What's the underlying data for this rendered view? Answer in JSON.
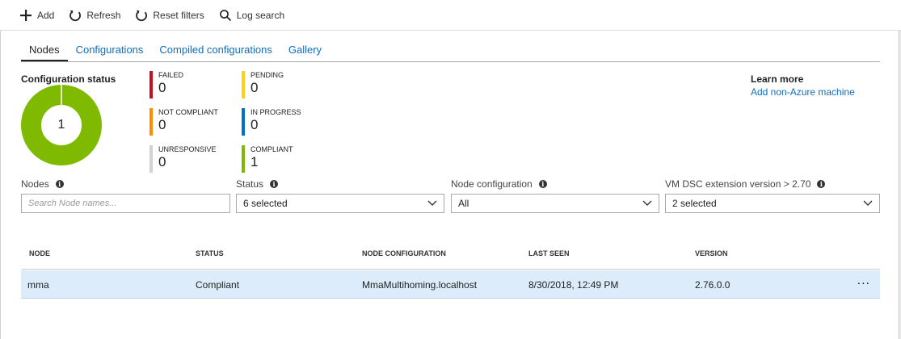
{
  "toolbar": {
    "add_label": "Add",
    "refresh_label": "Refresh",
    "reset_label": "Reset filters",
    "log_label": "Log search"
  },
  "tabs": [
    {
      "label": "Nodes",
      "active": true
    },
    {
      "label": "Configurations",
      "active": false
    },
    {
      "label": "Compiled configurations",
      "active": false
    },
    {
      "label": "Gallery",
      "active": false
    }
  ],
  "status": {
    "title": "Configuration status",
    "total": "1",
    "chart_color": "#7fba00",
    "items": [
      {
        "label": "FAILED",
        "value": "0",
        "color": "#c50f1f"
      },
      {
        "label": "NOT COMPLIANT",
        "value": "0",
        "color": "#ff8c00"
      },
      {
        "label": "UNRESPONSIVE",
        "value": "0",
        "color": "#d2d2d2"
      },
      {
        "label": "PENDING",
        "value": "0",
        "color": "#fcd116"
      },
      {
        "label": "IN PROGRESS",
        "value": "0",
        "color": "#0072c6"
      },
      {
        "label": "COMPLIANT",
        "value": "1",
        "color": "#7fba00"
      }
    ]
  },
  "learn": {
    "title": "Learn more",
    "link": "Add non-Azure machine"
  },
  "filters": {
    "nodes": {
      "label": "Nodes",
      "placeholder": "Search Node names..."
    },
    "status": {
      "label": "Status",
      "value": "6 selected"
    },
    "node_config": {
      "label": "Node configuration",
      "value": "All"
    },
    "extension": {
      "label": "VM DSC extension version > 2.70",
      "value": "2 selected"
    }
  },
  "grid": {
    "columns": [
      "NODE",
      "STATUS",
      "NODE CONFIGURATION",
      "LAST SEEN",
      "VERSION"
    ],
    "rows": [
      {
        "node": "mma",
        "status": "Compliant",
        "config": "MmaMultihoming.localhost",
        "last_seen": "8/30/2018, 12:49 PM",
        "version": "2.76.0.0",
        "more": "..."
      }
    ]
  }
}
